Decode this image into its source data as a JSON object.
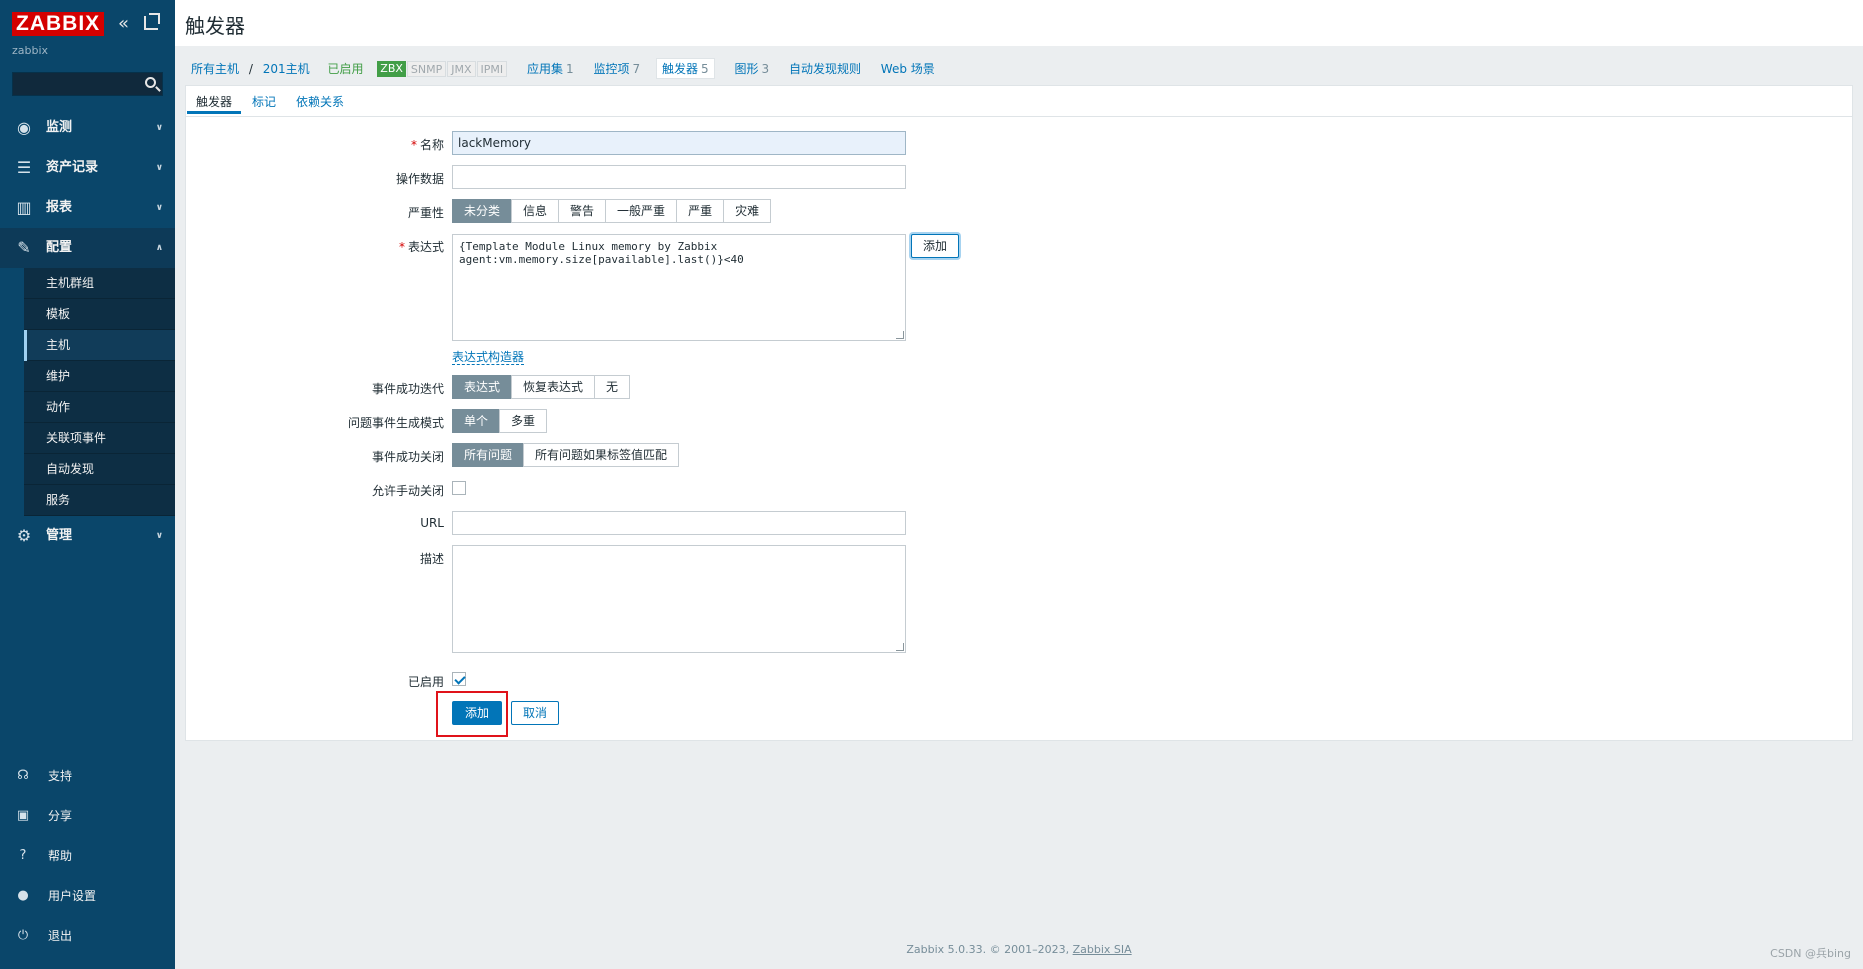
{
  "app": {
    "logo": "ZABBIX",
    "user": "zabbix",
    "search_placeholder": ""
  },
  "sidebar": {
    "menu": [
      {
        "label": "监测",
        "icon": "eye-icon"
      },
      {
        "label": "资产记录",
        "icon": "list-icon"
      },
      {
        "label": "报表",
        "icon": "bar-chart-icon"
      },
      {
        "label": "配置",
        "icon": "wrench-icon"
      },
      {
        "label": "管理",
        "icon": "gear-icon"
      }
    ],
    "config_items": [
      "主机群组",
      "模板",
      "主机",
      "维护",
      "动作",
      "关联项事件",
      "自动发现",
      "服务"
    ],
    "bottom": [
      {
        "label": "支持",
        "icon": "headset-icon"
      },
      {
        "label": "分享",
        "icon": "share-icon"
      },
      {
        "label": "帮助",
        "icon": "help-icon"
      },
      {
        "label": "用户设置",
        "icon": "user-icon"
      },
      {
        "label": "退出",
        "icon": "power-icon"
      }
    ]
  },
  "page": {
    "title": "触发器"
  },
  "breadcrumb": {
    "all_hosts": "所有主机",
    "sep": "/",
    "host": "201主机",
    "enabled": "已启用",
    "zbx": "ZBX",
    "snmp": "SNMP",
    "jmx": "JMX",
    "ipmi": "IPMI",
    "apps": "应用集",
    "apps_count": "1",
    "items": "监控项",
    "items_count": "7",
    "triggers": "触发器",
    "triggers_count": "5",
    "graphs": "图形",
    "graphs_count": "3",
    "discovery": "自动发现规则",
    "web": "Web 场景"
  },
  "tabs": [
    "触发器",
    "标记",
    "依赖关系"
  ],
  "form": {
    "name_label": "名称",
    "name_value": "lackMemory",
    "opdata_label": "操作数据",
    "opdata_value": "",
    "severity_label": "严重性",
    "severity_options": [
      "未分类",
      "信息",
      "警告",
      "一般严重",
      "严重",
      "灾难"
    ],
    "severity_selected": "未分类",
    "expression_label": "表达式",
    "expression_value": "{Template Module Linux memory by Zabbix\nagent:vm.memory.size[pavailable].last()}<40",
    "expression_add": "添加",
    "expression_builder": "表达式构造器",
    "ok_event_label": "事件成功迭代",
    "ok_event_options": [
      "表达式",
      "恢复表达式",
      "无"
    ],
    "problem_mode_label": "问题事件生成模式",
    "problem_mode_options": [
      "单个",
      "多重"
    ],
    "ok_close_label": "事件成功关闭",
    "ok_close_options": [
      "所有问题",
      "所有问题如果标签值匹配"
    ],
    "manual_close_label": "允许手动关闭",
    "url_label": "URL",
    "url_value": "",
    "description_label": "描述",
    "description_value": "",
    "enabled_label": "已启用",
    "submit": "添加",
    "cancel": "取消"
  },
  "footer": {
    "text": "Zabbix 5.0.33. © 2001–2023,",
    "link": "Zabbix SIA"
  },
  "watermark": "CSDN @兵bing",
  "colors": {
    "sidebar": "#0a466a",
    "accent": "#0275b8",
    "logo": "#d40000",
    "enabled": "#429e47",
    "highlight": "#e0131a"
  }
}
